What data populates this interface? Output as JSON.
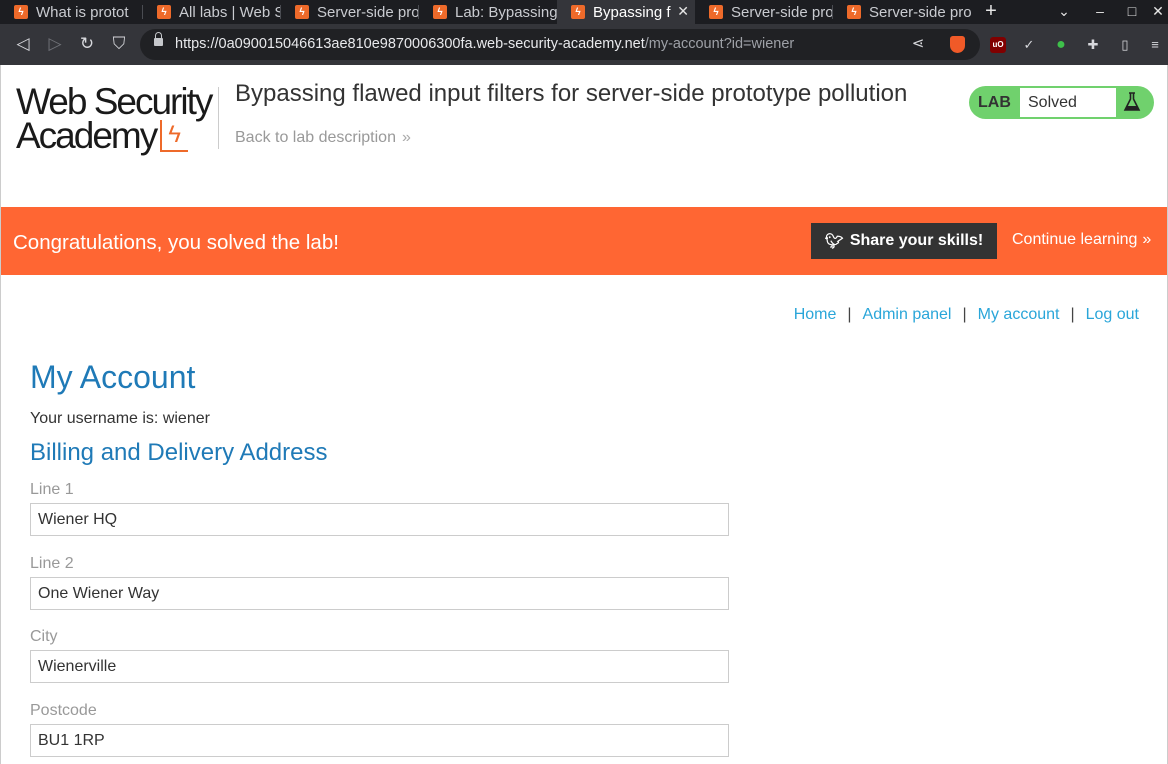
{
  "browser": {
    "tabs": [
      {
        "title": "What is protot"
      },
      {
        "title": "All labs | Web S"
      },
      {
        "title": "Server-side pro"
      },
      {
        "title": "Lab: Bypassing"
      },
      {
        "title": "Bypassing f"
      },
      {
        "title": "Server-side pro"
      },
      {
        "title": "Server-side pro"
      }
    ],
    "url_host": "https://0a090015046613ae810e9870006300fa.web-security-academy.net",
    "url_path": "/my-account?id=wiener"
  },
  "header": {
    "logo_line1": "Web Security",
    "logo_line2": "Academy",
    "lab_title": "Bypassing flawed input filters for server-side prototype pollution",
    "back_link": "Back to lab description",
    "badge_label": "LAB",
    "badge_status": "Solved"
  },
  "banner": {
    "message": "Congratulations, you solved the lab!",
    "share_label": "Share your skills!",
    "continue_label": "Continue learning"
  },
  "nav": {
    "home": "Home",
    "admin": "Admin panel",
    "account": "My account",
    "logout": "Log out"
  },
  "account": {
    "title": "My Account",
    "username_text": "Your username is: wiener",
    "address_heading": "Billing and Delivery Address",
    "fields": [
      {
        "label": "Line 1",
        "value": "Wiener HQ"
      },
      {
        "label": "Line 2",
        "value": "One Wiener Way"
      },
      {
        "label": "City",
        "value": "Wienerville"
      },
      {
        "label": "Postcode",
        "value": "BU1 1RP"
      }
    ]
  },
  "colors": {
    "banner": "#ff6633",
    "heading": "#1f7ab7",
    "link": "#2aa6d9",
    "badge": "#70d16d"
  }
}
